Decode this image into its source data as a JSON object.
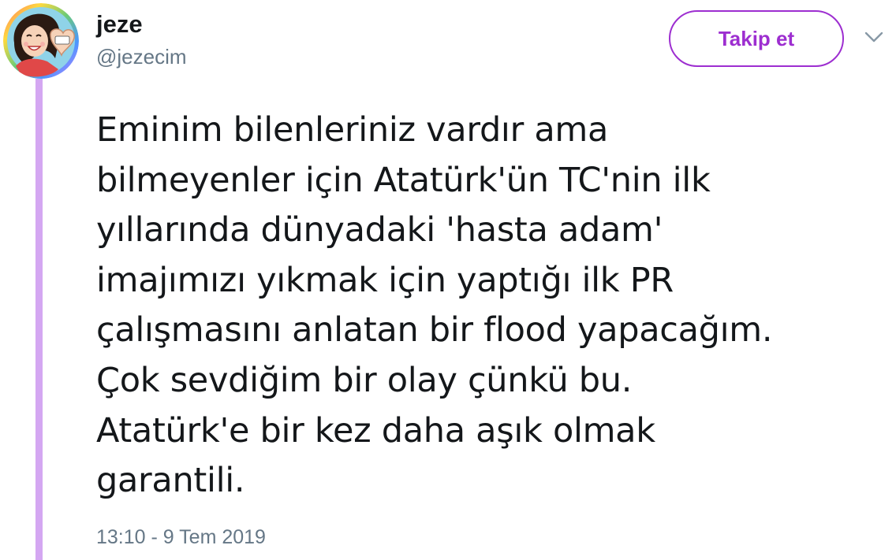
{
  "author": {
    "display_name": "jeze",
    "username": "@jezecim",
    "avatar_icon": "avatar-illustration-heart-hands"
  },
  "follow_button": {
    "label": "Takip et"
  },
  "menu": {
    "icon": "chevron-down-icon"
  },
  "tweet": {
    "text": "Eminim bilenleriniz vardır ama\nbilmeyenler için Atatürk'ün TC'nin ilk\nyıllarında dünyadaki 'hasta adam'\nimajımızı yıkmak için yaptığı ilk PR\nçalışmasını anlatan bir flood yapacağım.\nÇok sevdiğim bir olay çünkü bu.\nAtatürk'e bir kez daha aşık olmak\ngarantili.",
    "timestamp": "13:10 - 9 Tem 2019"
  },
  "colors": {
    "accent": "#9d2ed0",
    "thread_line": "#d4a7f2",
    "text": "#14171a",
    "secondary_text": "#657786"
  }
}
